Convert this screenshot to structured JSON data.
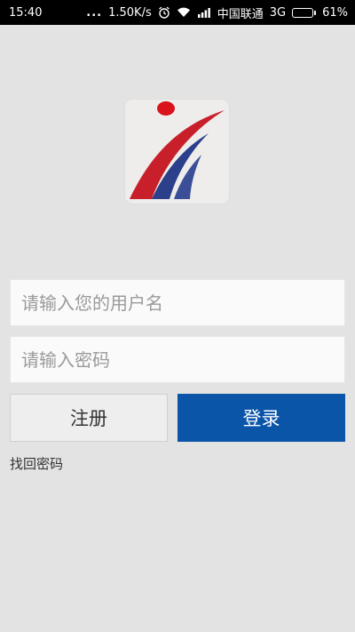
{
  "status_bar": {
    "time": "15:40",
    "dots": "...",
    "net_speed": "1.50K/s",
    "carrier": "中国联通",
    "network_type": "3G",
    "battery_percent": "61%",
    "battery_level": 0.61,
    "icons": [
      "alarm-icon",
      "wifi-icon",
      "signal-icon",
      "battery-icon"
    ]
  },
  "logo": {
    "icon": "app-logo-icon",
    "colors": {
      "red": "#d32a2a",
      "blue": "#2b3f8a",
      "background": "#efedeb"
    }
  },
  "login_form": {
    "username_placeholder": "请输入您的用户名",
    "username_value": "",
    "password_placeholder": "请输入密码",
    "password_value": ""
  },
  "buttons": {
    "register_label": "注册",
    "login_label": "登录"
  },
  "links": {
    "forgot_password": "找回密码"
  },
  "colors": {
    "background": "#e3e3e3",
    "primary": "#0b55a8",
    "secondary_button": "#eeeeee"
  }
}
